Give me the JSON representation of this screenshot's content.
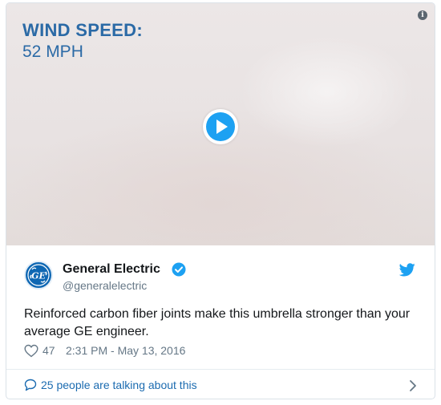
{
  "media": {
    "overlay_title": "WIND SPEED:",
    "overlay_value": "52 MPH",
    "play_icon": "play-icon",
    "info_icon": "info-icon",
    "info_glyph": "i"
  },
  "tweet": {
    "author_name": "General Electric",
    "handle": "@generalelectric",
    "verified": true,
    "text": "Reinforced carbon fiber joints make this umbrella stronger than your average GE engineer.",
    "likes": "47",
    "timestamp": "2:31 PM - May 13, 2016"
  },
  "footer": {
    "talking": "25 people are talking about this"
  },
  "colors": {
    "twitter_blue": "#1da1f2",
    "link_blue": "#1b6bb0",
    "overlay_blue": "#2b6aa6",
    "secondary_text": "#657786",
    "ge_blue": "#0e67b3"
  }
}
